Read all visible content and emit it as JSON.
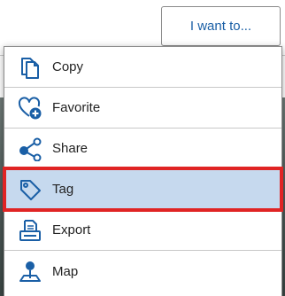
{
  "header": {
    "action_button_label": "I want to..."
  },
  "menu": {
    "items": [
      {
        "label": "Copy",
        "icon": "copy-icon",
        "selected": false
      },
      {
        "label": "Favorite",
        "icon": "heart-plus-icon",
        "selected": false
      },
      {
        "label": "Share",
        "icon": "share-icon",
        "selected": false
      },
      {
        "label": "Tag",
        "icon": "tag-icon",
        "selected": true
      },
      {
        "label": "Export",
        "icon": "export-icon",
        "selected": false
      },
      {
        "label": "Map",
        "icon": "map-pin-icon",
        "selected": false
      }
    ]
  },
  "colors": {
    "accent": "#1a5fa6",
    "selected_background": "#c6d9ee",
    "highlight_border": "#e02424"
  }
}
